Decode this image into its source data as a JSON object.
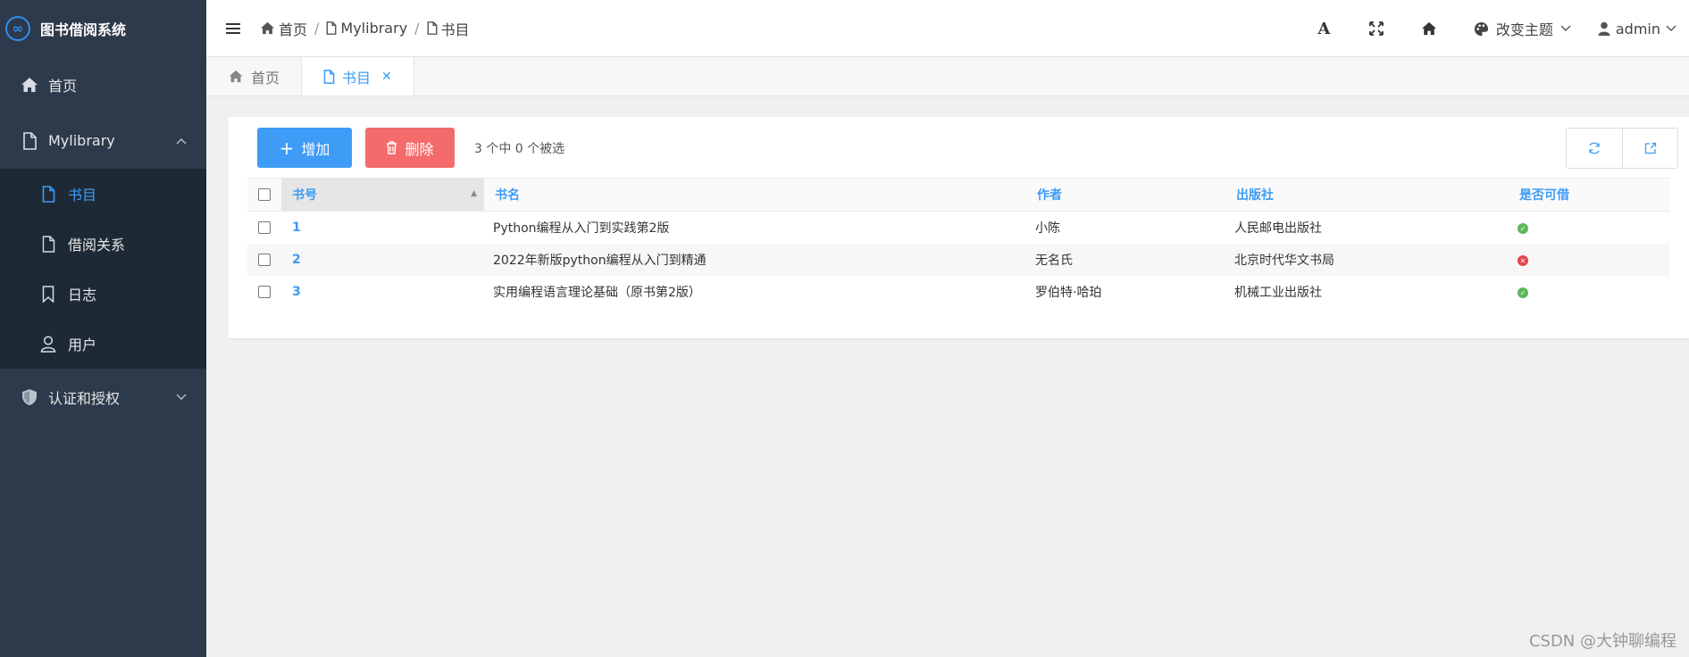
{
  "app": {
    "title": "图书借阅系统",
    "logo_glyph": "∞"
  },
  "sidebar": {
    "items": [
      {
        "label": "首页"
      },
      {
        "label": "Mylibrary"
      },
      {
        "label": "书目"
      },
      {
        "label": "借阅关系"
      },
      {
        "label": "日志"
      },
      {
        "label": "用户"
      },
      {
        "label": "认证和授权"
      }
    ]
  },
  "header": {
    "breadcrumb": [
      {
        "label": "首页"
      },
      {
        "label": "Mylibrary"
      },
      {
        "label": "书目"
      }
    ],
    "sep": "/",
    "font_icon": "A",
    "theme_label": "改变主题",
    "user_label": "admin"
  },
  "tabs": [
    {
      "label": "首页"
    },
    {
      "label": "书目"
    }
  ],
  "toolbar": {
    "add_label": "增加",
    "delete_label": "删除",
    "selection_text": "3 个中 0 个被选"
  },
  "table": {
    "headers": [
      "书号",
      "书名",
      "作者",
      "出版社",
      "是否可借"
    ],
    "rows": [
      {
        "id": "1",
        "name": "Python编程从入门到实践第2版",
        "author": "小陈",
        "publisher": "人民邮电出版社",
        "available": true
      },
      {
        "id": "2",
        "name": "2022年新版python编程从入门到精通",
        "author": "无名氏",
        "publisher": "北京时代华文书局",
        "available": false
      },
      {
        "id": "3",
        "name": "实用编程语言理论基础（原书第2版）",
        "author": "罗伯特·哈珀",
        "publisher": "机械工业出版社",
        "available": true
      }
    ]
  },
  "colors": {
    "accent": "#3c9cf7",
    "danger": "#f46b6b",
    "success": "#5cb85c",
    "sidebar": "#2d3a4b"
  },
  "watermark": "CSDN @大钟聊编程"
}
